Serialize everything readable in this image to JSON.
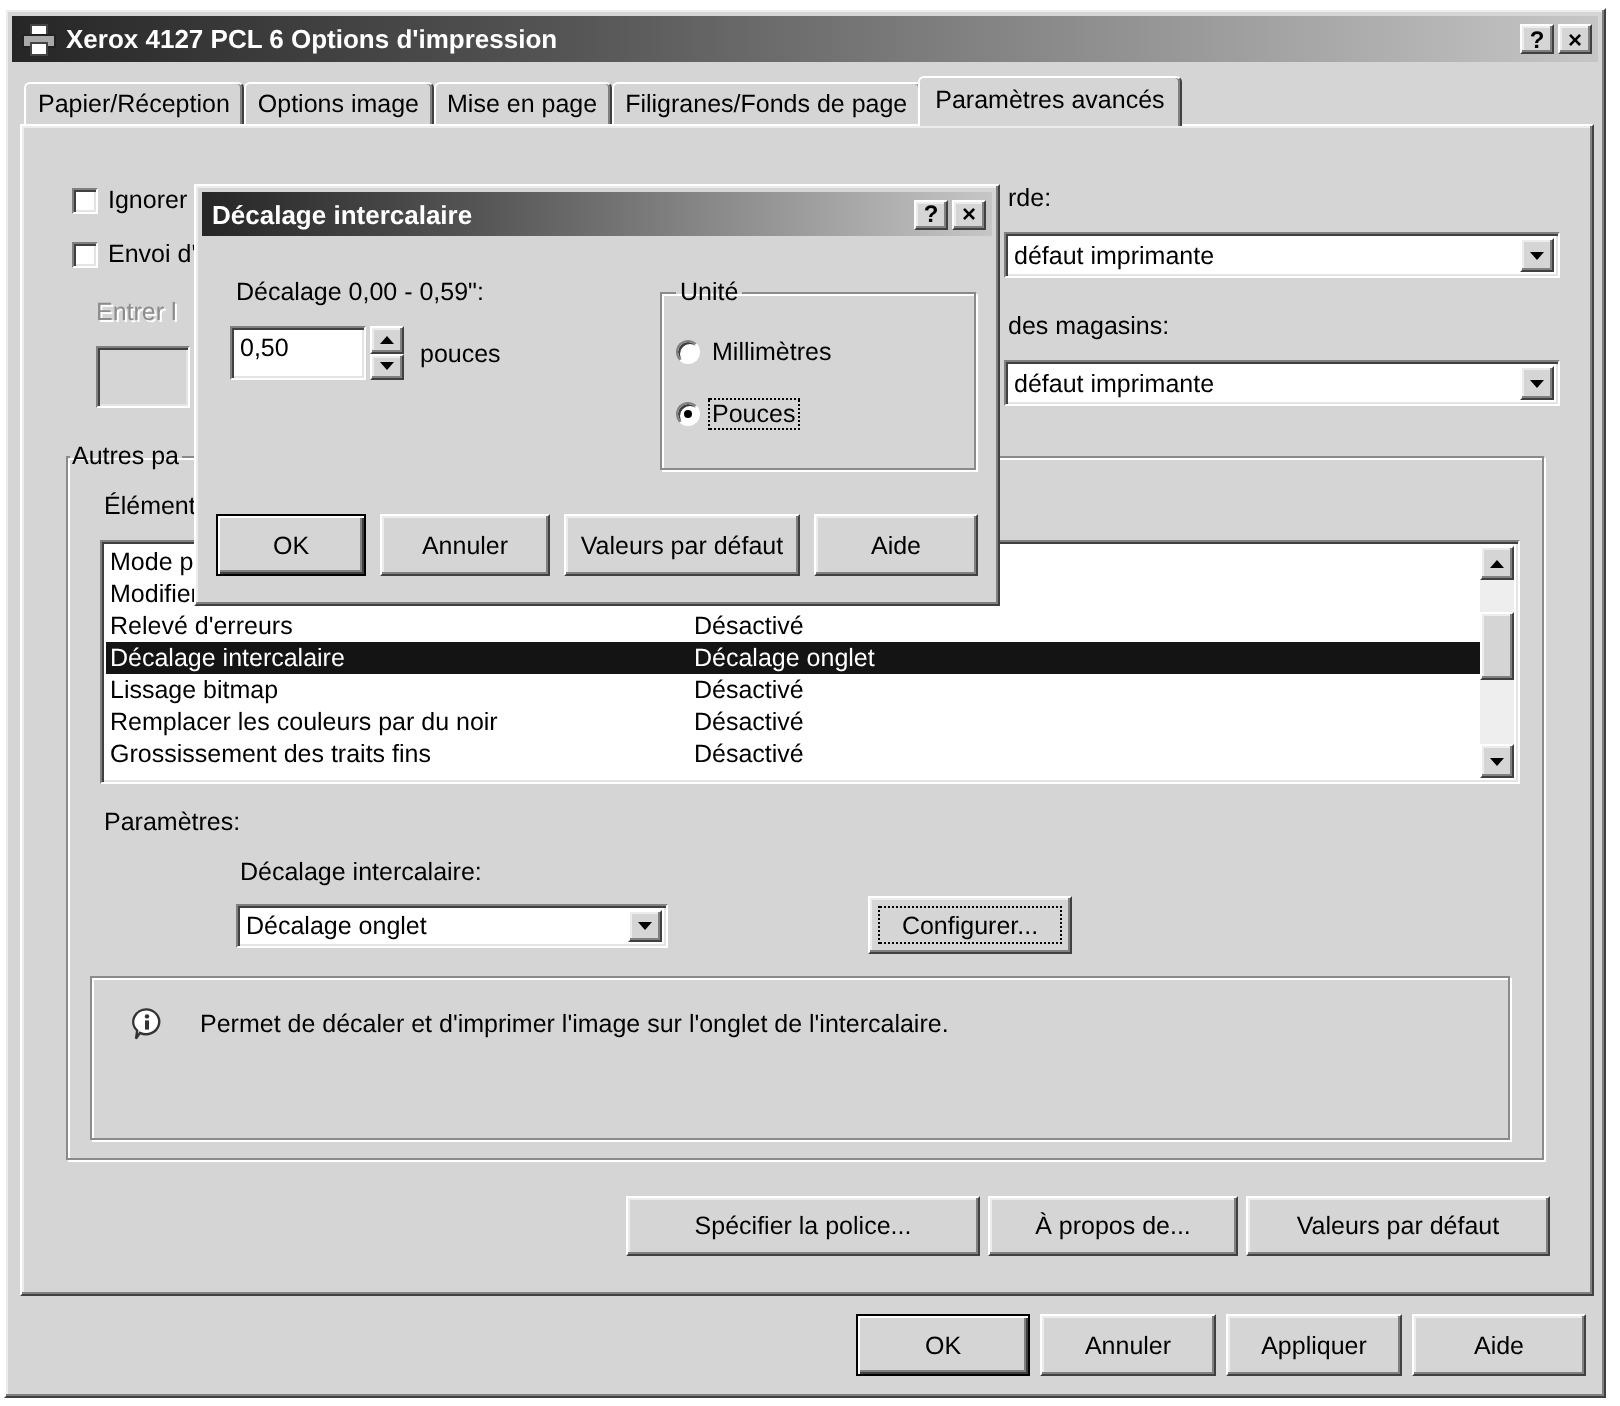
{
  "window": {
    "title": "Xerox 4127 PCL 6 Options d'impression",
    "title_buttons": [
      "?",
      "×"
    ]
  },
  "tabs": [
    {
      "label": "Papier/Réception",
      "selected": false
    },
    {
      "label": "Options image",
      "selected": false
    },
    {
      "label": "Mise en page",
      "selected": false
    },
    {
      "label": "Filigranes/Fonds de page",
      "selected": false
    },
    {
      "label": "Paramètres avancés",
      "selected": true
    }
  ],
  "panel": {
    "checkboxes": [
      {
        "label": "Ignorer",
        "checked": false
      },
      {
        "label": "Envoi d'",
        "checked": false
      }
    ],
    "entry": {
      "label": "Entrer l",
      "disabled": true
    },
    "selects": [
      {
        "label": "rde:",
        "value": "défaut imprimante"
      },
      {
        "label": "des magasins:",
        "value": "défaut imprimante"
      }
    ],
    "group": {
      "title": "Autres pa",
      "list_label": "Élément",
      "items": [
        {
          "name": "Mode p",
          "selected": false
        },
        {
          "name": "Modifier",
          "selected": false
        },
        {
          "name": "Relevé d'erreurs",
          "value": "Désactivé",
          "selected": false
        },
        {
          "name": "Décalage intercalaire",
          "value": "Décalage onglet",
          "selected": true
        },
        {
          "name": "Lissage bitmap",
          "value": "Désactivé",
          "selected": false
        },
        {
          "name": "Remplacer les couleurs par du noir",
          "value": "Désactivé",
          "selected": false
        },
        {
          "name": "Grossissement des traits fins",
          "value": "Désactivé",
          "selected": false
        }
      ],
      "parameters_label": "Paramètres:",
      "setting_label": "Décalage intercalaire:",
      "setting_value": "Décalage onglet",
      "configure": {
        "label": "Configurer...",
        "focused": true
      },
      "info": "Permet de décaler et d'imprimer l'image sur l'onglet de l'intercalaire."
    },
    "buttons": [
      "Spécifier la police...",
      "À propos de...",
      "Valeurs par défaut"
    ]
  },
  "buttons": [
    {
      "label": "OK",
      "default": true
    },
    {
      "label": "Annuler",
      "default": false
    },
    {
      "label": "Appliquer",
      "default": false
    },
    {
      "label": "Aide",
      "default": false
    }
  ],
  "dialog": {
    "title": "Décalage intercalaire",
    "title_buttons": [
      "?",
      "×"
    ],
    "offset_label": "Décalage 0,00 - 0,59\":",
    "offset_value": "0,50",
    "unit_suffix": "pouces",
    "unit_group": "Unité",
    "units": [
      {
        "label": "Millimètres",
        "selected": false,
        "focused": false
      },
      {
        "label": "Pouces",
        "selected": true,
        "focused": true
      }
    ],
    "buttons": [
      {
        "label": "OK",
        "default": true
      },
      {
        "label": "Annuler",
        "default": false
      },
      {
        "label": "Valeurs par défaut",
        "default": false
      },
      {
        "label": "Aide",
        "default": false
      }
    ]
  }
}
